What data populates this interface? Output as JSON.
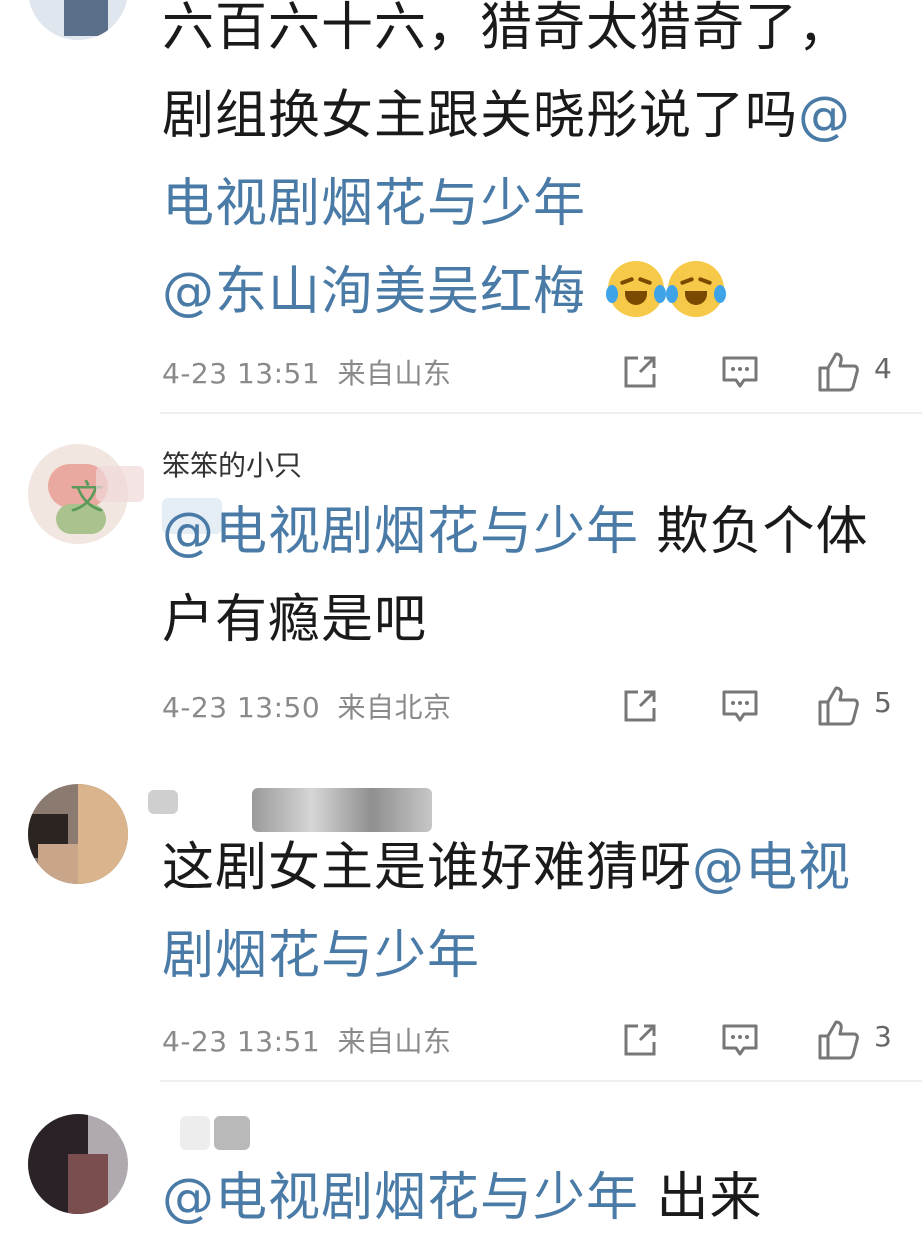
{
  "comments": [
    {
      "username": "",
      "body_parts": [
        {
          "text": "六百六十六，猎奇太猎奇了，剧组换女主跟关晓彤说了吗",
          "mention": false
        },
        {
          "text": "@电视剧烟花与少年",
          "mention": true
        },
        {
          "text": " ",
          "mention": false
        },
        {
          "text": "@东山洵美吴红梅",
          "mention": true
        }
      ],
      "emojis": [
        "laugh-cry-emoji",
        "laugh-cry-emoji"
      ],
      "time": "4-23 13:51",
      "location": "来自山东",
      "likes": "4"
    },
    {
      "username": "笨笨的小只",
      "body_parts": [
        {
          "text": "@电视剧烟花与少年",
          "mention": true
        },
        {
          "text": " 欺负个体户有瘾是吧",
          "mention": false
        }
      ],
      "time": "4-23 13:50",
      "location": "来自北京",
      "likes": "5"
    },
    {
      "username": "",
      "body_parts": [
        {
          "text": "这剧女主是谁好难猜呀",
          "mention": false
        },
        {
          "text": "@电视剧烟花与少年",
          "mention": true
        }
      ],
      "time": "4-23 13:51",
      "location": "来自山东",
      "likes": "3"
    },
    {
      "username": "",
      "body_parts": [
        {
          "text": "@电视剧烟花与少年",
          "mention": true
        },
        {
          "text": " 出来",
          "mention": false
        }
      ],
      "time": "",
      "location": "",
      "likes": ""
    }
  ],
  "colors": {
    "mention": "#4a7ba7",
    "text": "#1a1a1a",
    "meta": "#8a8a8a",
    "divider": "#eeeeee"
  },
  "icons": [
    "share-icon",
    "reply-icon",
    "like-icon"
  ]
}
